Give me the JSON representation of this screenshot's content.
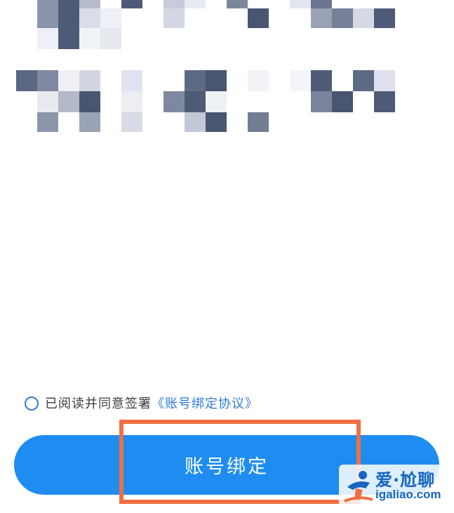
{
  "agreement": {
    "text": "已阅读并同意签署",
    "link": "《账号绑定协议》"
  },
  "primary_button": {
    "label": "账号绑定"
  },
  "watermark": {
    "brand": "爱·尬聊",
    "domain": "igaliao.com"
  },
  "colors": {
    "button_blue": "#1f8cf2",
    "link_blue": "#2f7bd6",
    "highlight_orange": "#ef6f42"
  }
}
